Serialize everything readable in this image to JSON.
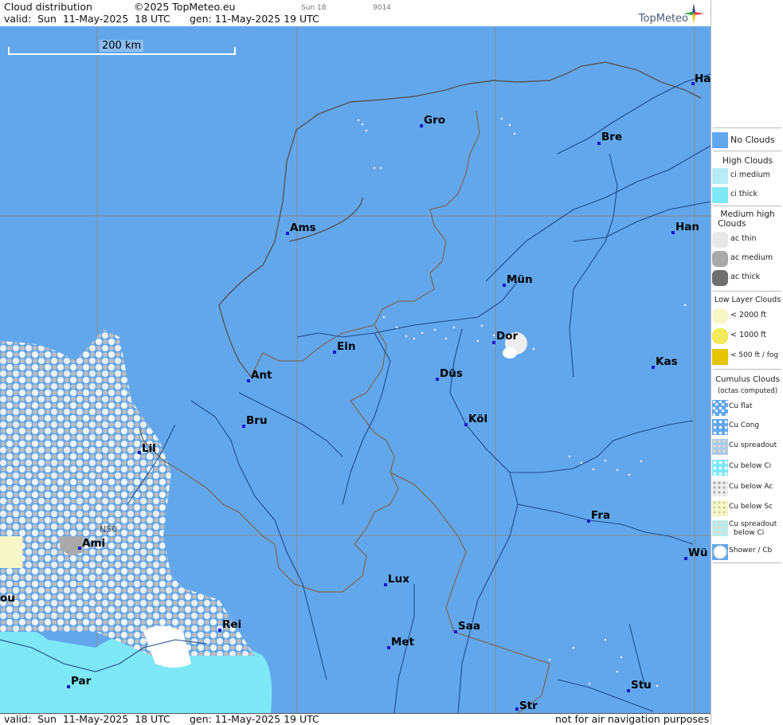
{
  "header": {
    "title": "Cloud distribution",
    "copyright": "©2025 TopMeteo.eu",
    "sun_label": "Sun 18",
    "code": "9014",
    "valid": "valid:  Sun  11-May-2025  18 UTC",
    "generated": "gen: 11-May-2025 19 UTC",
    "logo": "TopMeteo"
  },
  "map": {
    "scale_label": "200 km",
    "grid_label": "N50",
    "cities": [
      {
        "name": "Gro"
      },
      {
        "name": "Bre"
      },
      {
        "name": "Ha"
      },
      {
        "name": "Ams"
      },
      {
        "name": "Han"
      },
      {
        "name": "Mün"
      },
      {
        "name": "Dor"
      },
      {
        "name": "Ein"
      },
      {
        "name": "Ant"
      },
      {
        "name": "Düs"
      },
      {
        "name": "Kas"
      },
      {
        "name": "Bru"
      },
      {
        "name": "Köl"
      },
      {
        "name": "Lil"
      },
      {
        "name": "Ami"
      },
      {
        "name": "Fra"
      },
      {
        "name": "Wü"
      },
      {
        "name": "Lux"
      },
      {
        "name": "Rei"
      },
      {
        "name": "Saa"
      },
      {
        "name": "Met"
      },
      {
        "name": "Par"
      },
      {
        "name": "Stu"
      },
      {
        "name": "Str"
      },
      {
        "name": "ou"
      }
    ]
  },
  "footer": {
    "valid": "valid:  Sun  11-May-2025  18 UTC",
    "generated": "gen: 11-May-2025 19 UTC",
    "disclaimer": "not for air navigation purposes"
  },
  "legend": {
    "no_clouds": "No Clouds",
    "high_title": "High Clouds",
    "ci_medium": "ci medium",
    "ci_thick": "ci thick",
    "medium_title_1": "Medium high",
    "medium_title_2": "Clouds",
    "ac_thin": "ac thin",
    "ac_medium": "ac medium",
    "ac_thick": "ac thick",
    "low_title": "Low Layer Clouds",
    "low_2000": "< 2000 ft",
    "low_1000": "< 1000 ft",
    "low_500": "< 500 ft / fog",
    "cu_title_1": "Cumulus Clouds",
    "cu_title_2": "(octas computed)",
    "cu_flat": "Cu flat",
    "cu_cong": "Cu Cong",
    "cu_spreadout": "Cu spreadout",
    "cu_below_ci": "Cu below Ci",
    "cu_below_ac": "Cu below Ac",
    "cu_below_sc": "Cu below Sc",
    "cu_spread_ci_1": "Cu spreadout",
    "cu_spread_ci_2": "below Ci",
    "shower": "Shower / Cb",
    "colors": {
      "no_clouds": "#62a7ec",
      "ci_medium": "#b8ecf4",
      "ci_thick": "#7fe8f7",
      "ac_thin": "#e8e8e8",
      "ac_medium": "#a9a9a9",
      "ac_thick": "#6f6f6f",
      "low_2000": "#f6f6c8",
      "low_1000": "#f2ea5a",
      "low_500": "#e5c400"
    }
  }
}
